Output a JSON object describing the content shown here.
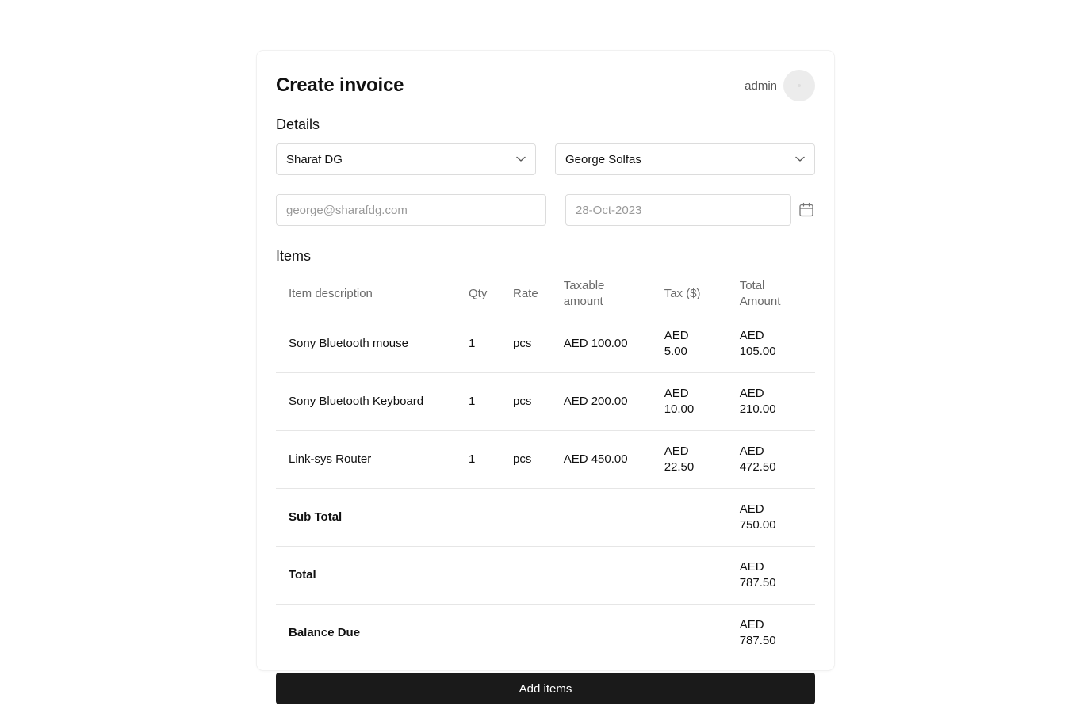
{
  "header": {
    "title": "Create invoice",
    "user_name": "admin"
  },
  "details": {
    "section_title": "Details",
    "company_select": {
      "selected": "Sharaf DG"
    },
    "contact_select": {
      "selected": "George Solfas"
    },
    "email_input": {
      "placeholder": "george@sharafdg.com"
    },
    "date_input": {
      "placeholder": "28-Oct-2023"
    }
  },
  "items": {
    "section_title": "Items",
    "columns": [
      "Item description",
      "Qty",
      "Rate",
      "Taxable amount",
      "Tax ($)",
      "Total Amount"
    ],
    "rows": [
      {
        "description": "Sony Bluetooth mouse",
        "qty": "1",
        "rate": "pcs",
        "taxable": "AED 100.00",
        "tax": "AED 5.00",
        "total": "AED 105.00"
      },
      {
        "description": "Sony Bluetooth Keyboard",
        "qty": "1",
        "rate": "pcs",
        "taxable": "AED 200.00",
        "tax": "AED 10.00",
        "total": "AED 210.00"
      },
      {
        "description": "Link-sys Router",
        "qty": "1",
        "rate": "pcs",
        "taxable": "AED 450.00",
        "tax": "AED 22.50",
        "total": "AED 472.50"
      }
    ],
    "summary": [
      {
        "label": "Sub Total",
        "value": "AED 750.00"
      },
      {
        "label": "Total",
        "value": "AED 787.50"
      },
      {
        "label": "Balance Due",
        "value": "AED 787.50"
      }
    ]
  },
  "actions": {
    "add_items_label": "Add items"
  },
  "icons": {
    "company_select": "chevron-down-icon",
    "contact_select": "chevron-down-icon",
    "date": "calendar-icon"
  }
}
